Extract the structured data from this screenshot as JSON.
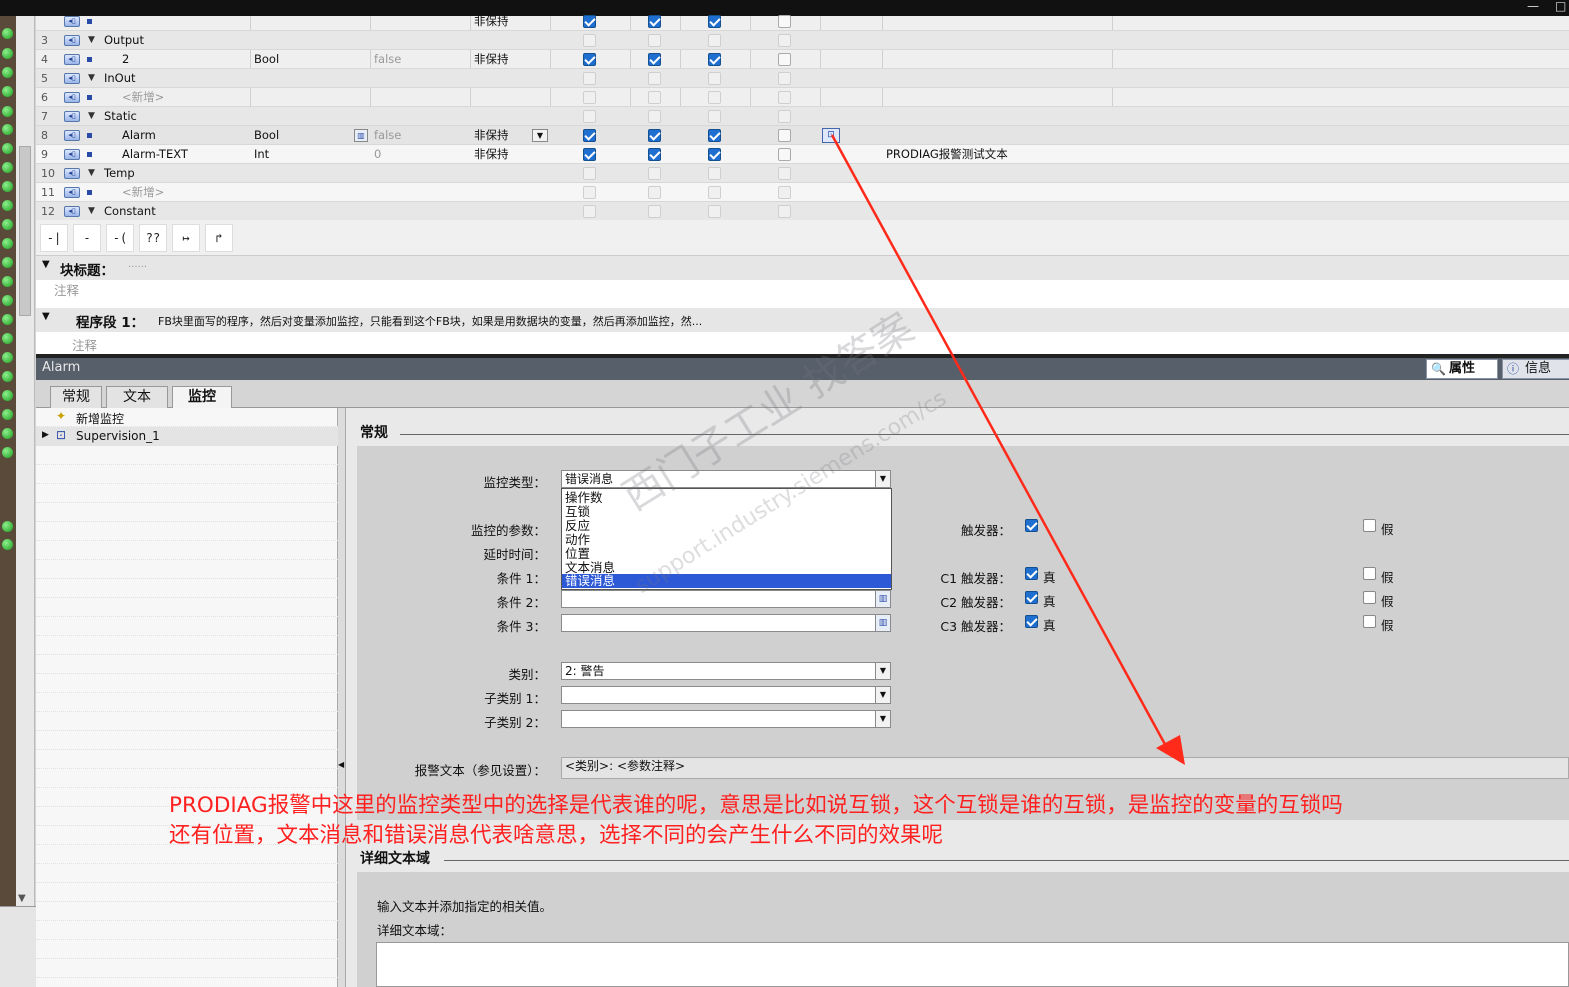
{
  "window_controls": {
    "minimize": "—",
    "maximize": "□"
  },
  "interface_rows": [
    {
      "num": "",
      "name": "",
      "type": "",
      "default": "",
      "retain": "非保持",
      "checks": [
        true,
        true,
        true,
        false
      ]
    },
    {
      "num": "3",
      "name": "Output",
      "kind": "section"
    },
    {
      "num": "4",
      "name": "2",
      "type": "Bool",
      "default": "false",
      "retain": "非保持",
      "checks": [
        true,
        true,
        true,
        false
      ]
    },
    {
      "num": "5",
      "name": "InOut",
      "kind": "section"
    },
    {
      "num": "6",
      "name": "<新增>",
      "kind": "add"
    },
    {
      "num": "7",
      "name": "Static",
      "kind": "section"
    },
    {
      "num": "8",
      "name": "Alarm",
      "type": "Bool",
      "default": "false",
      "retain": "非保持",
      "checks": [
        true,
        true,
        true,
        false
      ]
    },
    {
      "num": "9",
      "name": "Alarm-TEXT",
      "type": "Int",
      "default": "0",
      "retain": "非保持",
      "checks": [
        true,
        true,
        true,
        false
      ],
      "comment": "PRODIAG报警测试文本"
    },
    {
      "num": "10",
      "name": "Temp",
      "kind": "section"
    },
    {
      "num": "11",
      "name": "<新增>",
      "kind": "add"
    },
    {
      "num": "12",
      "name": "Constant",
      "kind": "section"
    }
  ],
  "ladder_toolbar": [
    "-| |-",
    "-|/|-",
    "-( )-",
    "??",
    "↦",
    "↱"
  ],
  "block": {
    "title_label": "块标题：",
    "title_value": "......",
    "comment_placeholder": "注释",
    "network_label": "程序段 1：",
    "network_text": "FB块里面写的程序，然后对变量添加监控，只能看到这个FB块，如果是用数据块的变量，然后再添加监控，然...",
    "network_comment": "注释"
  },
  "inspector": {
    "title": "Alarm",
    "tab_properties": "属性",
    "tab_info": "信息",
    "tabs": [
      "常规",
      "文本",
      "监控"
    ],
    "active_tab": "监控"
  },
  "tree": {
    "add_item": "新增监控",
    "items": [
      "Supervision_1"
    ]
  },
  "general": {
    "header": "常规",
    "supervision_type_label": "监控类型：",
    "supervision_type_value": "错误消息",
    "dropdown_options": [
      "操作数",
      "互锁",
      "反应",
      "动作",
      "位置",
      "文本消息",
      "错误消息"
    ],
    "selected_option": "错误消息",
    "param_label": "监控的参数：",
    "delay_label": "延时时间：",
    "cond1_label": "条件 1：",
    "cond2_label": "条件 2：",
    "cond3_label": "条件 3：",
    "trigger_label": "触发器：",
    "c1_trigger_label": "C1 触发器：",
    "c2_trigger_label": "C2 触发器：",
    "c3_trigger_label": "C3 触发器：",
    "true_label": "真",
    "false_label": "假",
    "category_label": "类别：",
    "category_value": "2: 警告",
    "subcat1_label": "子类别 1：",
    "subcat2_label": "子类别 2：",
    "alarm_text_label": "报警文本（参见设置）：",
    "alarm_text_value": "<类别>: <参数注释>"
  },
  "detail": {
    "header": "详细文本域",
    "hint": "输入文本并添加指定的相关值。",
    "field_label": "详细文本域："
  },
  "annotation": {
    "line1": "PRODIAG报警中这里的监控类型中的选择是代表谁的呢，意思是比如说互锁，这个互锁是谁的互锁，是监控的变量的互锁吗",
    "line2": "还有位置，文本消息和错误消息代表啥意思，选择不同的会产生什么不同的效果呢",
    "color": "#ff2020"
  },
  "watermark": {
    "line1": "西门子工业 找答案",
    "line2": "support.industry.siemens.com/cs"
  }
}
